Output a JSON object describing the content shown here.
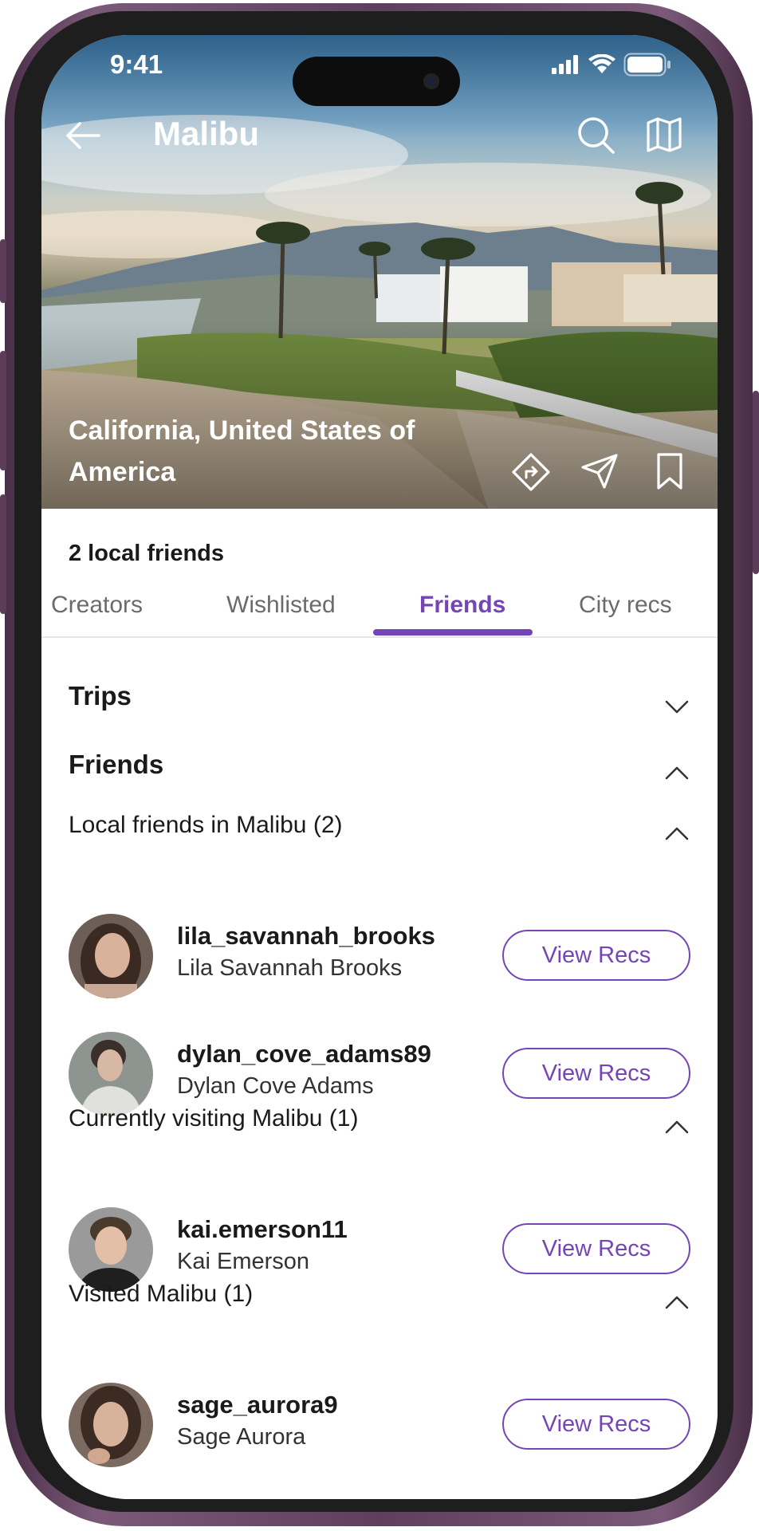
{
  "status_bar": {
    "time": "9:41"
  },
  "header": {
    "title": "Malibu",
    "back_icon": "arrow-left-icon",
    "search_icon": "search-icon",
    "map_icon": "map-icon"
  },
  "hero": {
    "location": "California, United States of America",
    "actions": [
      "directions-icon",
      "send-icon",
      "bookmark-icon"
    ]
  },
  "summary": {
    "friends_count": "2 local friends"
  },
  "tabs": [
    {
      "label": "Creators",
      "active": false
    },
    {
      "label": "Wishlisted",
      "active": false
    },
    {
      "label": "Friends",
      "active": true
    },
    {
      "label": "City recs",
      "active": false
    }
  ],
  "sections": {
    "trips": {
      "title": "Trips",
      "expanded": false
    },
    "friends": {
      "title": "Friends",
      "expanded": true
    }
  },
  "groups": [
    {
      "title": "Local friends in Malibu (2)",
      "people": [
        {
          "username": "lila_savannah_brooks",
          "name": "Lila Savannah Brooks",
          "button": "View Recs"
        },
        {
          "username": "dylan_cove_adams89",
          "name": "Dylan Cove Adams",
          "button": "View Recs"
        }
      ]
    },
    {
      "title": "Currently visiting Malibu (1)",
      "people": [
        {
          "username": "kai.emerson11",
          "name": "Kai Emerson",
          "button": "View Recs"
        }
      ]
    },
    {
      "title": "Visited Malibu (1)",
      "people": [
        {
          "username": "sage_aurora9",
          "name": "Sage Aurora",
          "button": "View Recs"
        }
      ]
    }
  ],
  "colors": {
    "accent": "#7445b5",
    "frame": "#5f3f5d",
    "text": "#1a1a1a"
  }
}
